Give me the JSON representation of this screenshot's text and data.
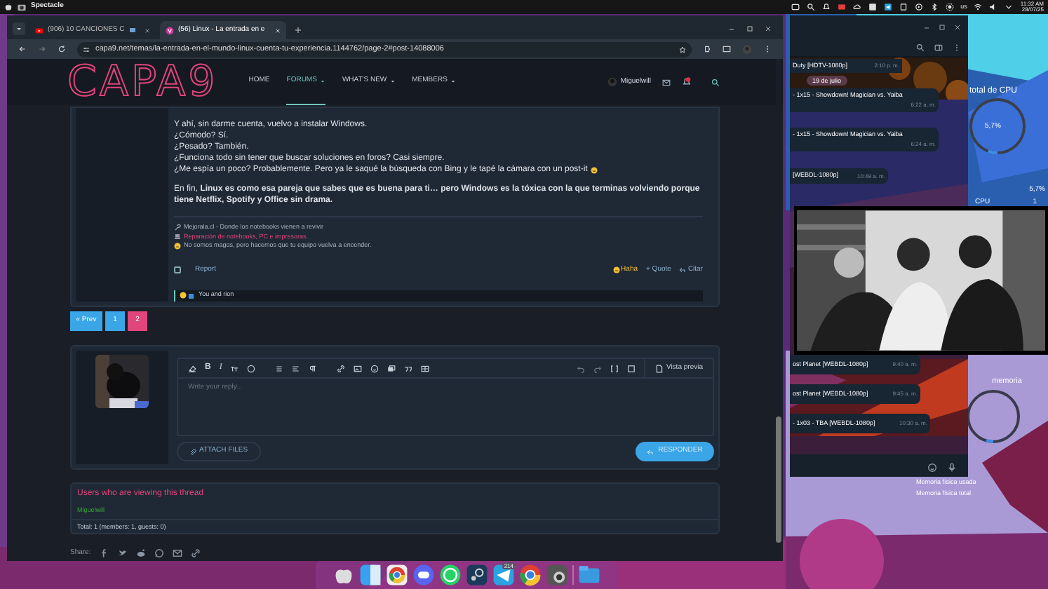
{
  "top_panel": {
    "app": "Spectacle",
    "keyboard_layout": "us",
    "clock": {
      "time": "11:32 AM",
      "date": "28/07/25"
    }
  },
  "browser": {
    "tabs": [
      {
        "label": "(906) 10 CANCIONES C",
        "selected": false
      },
      {
        "label": "(56) Linux - La entrada en e",
        "selected": true
      }
    ],
    "url": "capa9.net/temas/la-entrada-en-el-mundo-linux-cuenta-tu-experiencia.1144762/page-2#post-14088006",
    "site": {
      "logo": "CAPA9",
      "nav": [
        {
          "label": "HOME",
          "selected": false,
          "dropdown": false
        },
        {
          "label": "FORUMS",
          "selected": true,
          "dropdown": true
        },
        {
          "label": "WHAT'S NEW",
          "selected": false,
          "dropdown": true
        },
        {
          "label": "MEMBERS",
          "selected": false,
          "dropdown": true
        }
      ],
      "username": "Miguelwill",
      "post": {
        "lines": [
          "Y ahí, sin darme cuenta, vuelvo a instalar Windows.",
          "¿Cómodo? Sí.",
          "¿Pesado? También.",
          "¿Funciona todo sin tener que buscar soluciones en foros? Casi siempre.",
          "¿Me espía un poco? Probablemente. Pero ya le saqué la búsqueda con Bing y le tapé la cámara con un post-it"
        ],
        "conclusion": "En fin, **Linux es como esa pareja que sabes que es buena para ti… pero Windows es la tóxica con la que terminas volviendo porque tiene Netflix, Spotify y Office sin drama.**",
        "signature": [
          {
            "kind": "wrench",
            "text": "Mejorala.cl - Donde los notebooks vienen a revivir"
          },
          {
            "kind": "laptop",
            "text": "Reparación de notebooks, PC e impresoras."
          },
          {
            "kind": "face",
            "text": "No somos magos, pero hacemos que tu equipo vuelva a encender."
          }
        ],
        "report": "Report",
        "checked": false,
        "actions": [
          {
            "kind": "haha",
            "label": "Haha"
          },
          {
            "kind": "quote",
            "label": "+ Quote"
          },
          {
            "kind": "cite",
            "label": "Citar"
          }
        ],
        "reactions": "You and rion"
      },
      "pagination": [
        {
          "label": "« Prev",
          "selected": false
        },
        {
          "label": "1",
          "selected": false
        },
        {
          "label": "2",
          "selected": true
        }
      ],
      "reply": {
        "format_buttons": [
          {
            "kind": "bold",
            "label": "B"
          },
          {
            "kind": "italic",
            "label": "I"
          }
        ],
        "preview": "Vista previa",
        "placeholder": "Write your reply...",
        "attach": "ATTACH FILES",
        "submit": "RESPONDER"
      },
      "viewers": {
        "title": "Users who are viewing this thread",
        "members": [
          "Miguelwill"
        ],
        "total": "Total: 1 (members: 1, guests: 0)"
      },
      "share_label": "Share:"
    }
  },
  "telegram": {
    "header": {
      "text": "Duty [HDTV-1080p]",
      "time": "2:10 p. m."
    },
    "date": "19 de julio",
    "messages_top": [
      {
        "text": "- 1x15 - Showdown! Magician vs. Yaiba",
        "time": "6:22 a. m."
      },
      {
        "text": "- 1x15 - Showdown! Magician vs. Yaiba",
        "time": "6:24 a. m."
      },
      {
        "text": "[WEBDL-1080p]",
        "time": "10:49 a. m."
      }
    ],
    "messages_bottom": [
      {
        "text": "ost Planet [WEBDL-1080p]",
        "time": "9:40 a. m."
      },
      {
        "text": "ost Planet [WEBDL-1080p]",
        "time": "9:45 a. m."
      },
      {
        "text": "- 1x03 - TBA [WEBDL-1080p]",
        "time": "10:30 a. m."
      }
    ]
  },
  "widgets": {
    "cpu": {
      "title": "total de CPU",
      "gauge": "5,7%",
      "reading": "5,7%",
      "row_label": "CPU",
      "row_value": "1",
      "level": 0.057
    },
    "memory": {
      "title": "memoria",
      "rows": [
        "Memoria física usada",
        "Memoria física total"
      ]
    }
  },
  "dock": {
    "badge": "214"
  }
}
